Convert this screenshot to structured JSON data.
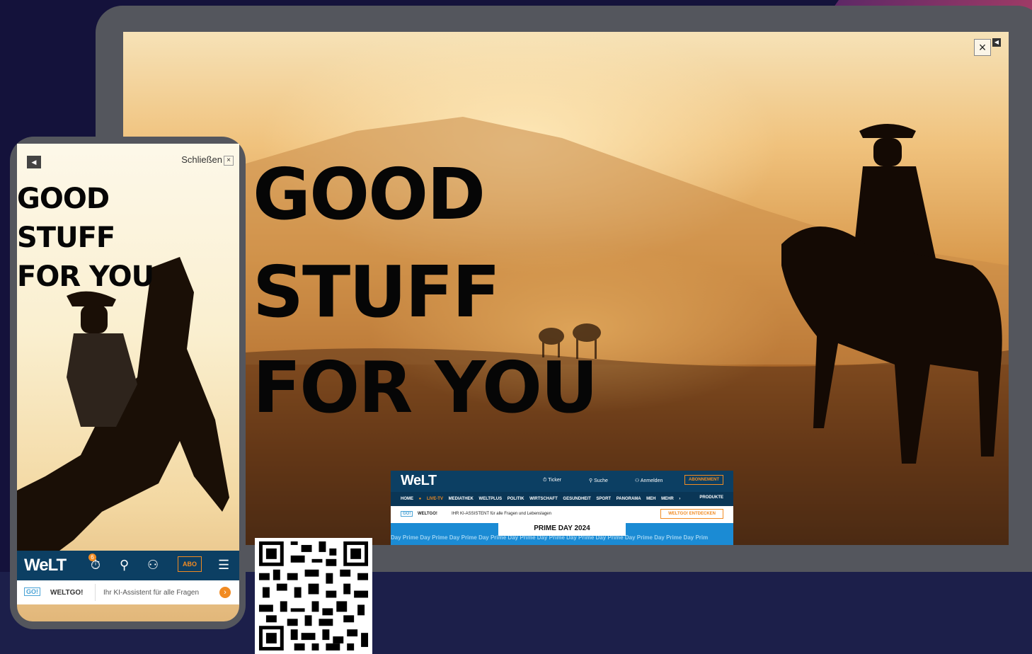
{
  "desktop": {
    "headline": [
      "GOOD",
      "STUFF",
      "FOR YOU"
    ],
    "close_icon": "×",
    "speaker_icon": "speaker-icon",
    "site": {
      "logo": "WeLT",
      "header_items": [
        "Ticker",
        "Suche",
        "Anmelden"
      ],
      "abo_button": "ABONNEMENT",
      "nav": "HOME",
      "nav_live": "● LIVE-TV",
      "nav_rest": "MEDIATHEK WELTPLUS POLITIK WIRTSCHAFT GESUNDHEIT SPORT PANORAMA MEH MEHR ›",
      "produkte": "PRODUKTE",
      "go_tag": "GO!",
      "go_title": "WELTGO!",
      "go_text": "IHR KI-ASSISTENT für alle Fragen und Lebenslagen",
      "go_button": "WELTGO! ENTDECKEN",
      "prime_label": "PRIME DAY 2024",
      "prime_repeat": "Day Prime Day Prime Day Prime Day Prime Day Prime Day Prime Day Prime Day Prime Day Prime Day Prime Day Prim"
    }
  },
  "mobile": {
    "close_label": "Schließen",
    "close_icon": "×",
    "headline": [
      "GOOD",
      "STUFF",
      "FOR YOU"
    ],
    "logo": "WeLT",
    "ticker_badge": "6",
    "abo_button": "ABO",
    "go_tag": "GO!",
    "go_title": "WELTGO!",
    "go_text": "Ihr KI-Assistent für alle Fragen",
    "go_arrow": "›"
  },
  "colors": {
    "background": "#14123b",
    "device_frame": "#54565d",
    "welt_blue": "#0c3f63",
    "accent_orange": "#f18b22",
    "prime_blue": "#1b8bd4"
  }
}
